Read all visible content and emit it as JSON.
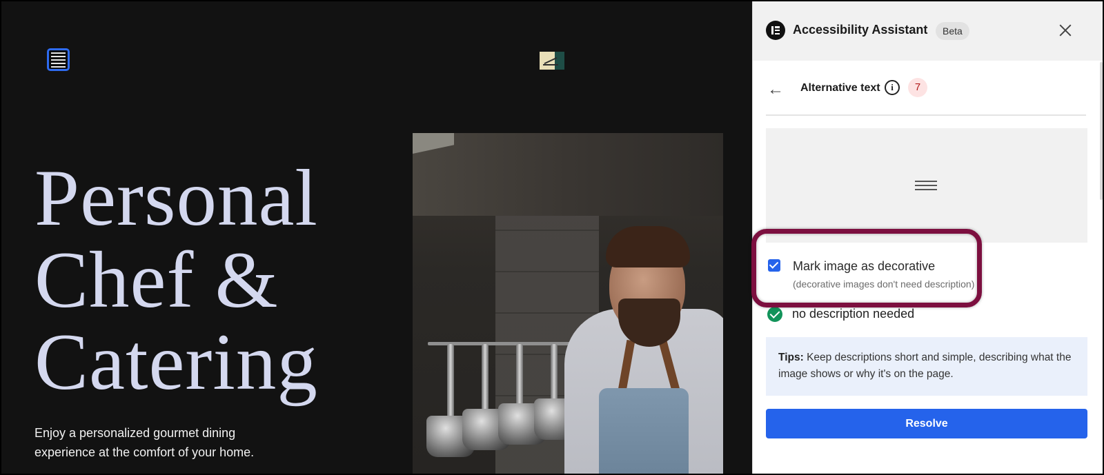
{
  "site": {
    "hero_title_line1": "Personal",
    "hero_title_line2": "Chef &",
    "hero_title_line3": "Catering",
    "hero_subtitle": "Enjoy a personalized gourmet dining experience at the comfort of your home."
  },
  "panel": {
    "title": "Accessibility Assistant",
    "badge": "Beta",
    "section_title": "Alternative text",
    "issue_count": "7",
    "checkbox_label": "Mark image as decorative",
    "checkbox_hint": "(decorative images don't need description)",
    "checkbox_checked": true,
    "status_text": "no description needed",
    "tips_label": "Tips:",
    "tips_text": "Keep descriptions short and simple, describing what the image shows or why it's on the page.",
    "resolve_label": "Resolve"
  },
  "colors": {
    "accent": "#2563eb",
    "highlight": "#7c0f3f",
    "success": "#12935a",
    "hero_text": "#d4d8ef"
  },
  "icons": [
    "hamburger-icon",
    "logo-icon",
    "elementor-icon",
    "close-icon",
    "back-arrow-icon",
    "info-icon",
    "check-icon",
    "image-placeholder-icon"
  ]
}
